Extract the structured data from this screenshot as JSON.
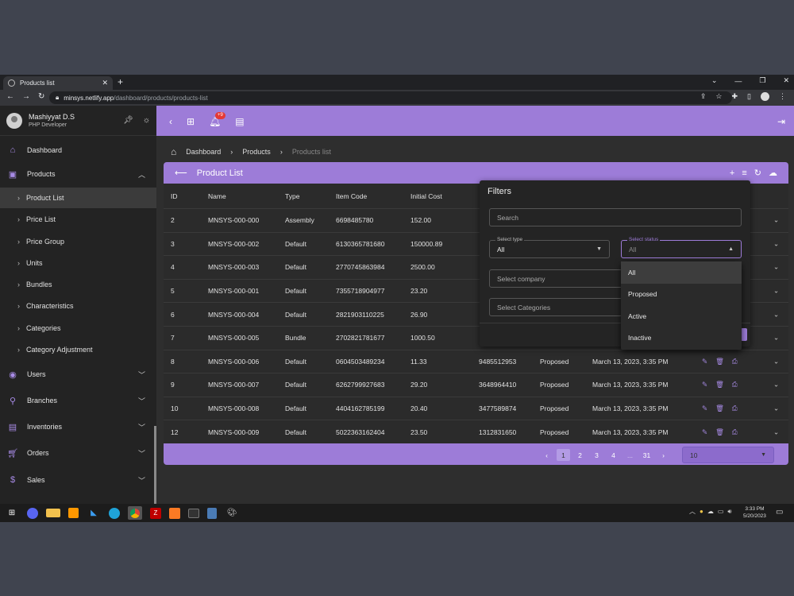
{
  "browser": {
    "tab_title": "Products list",
    "url_host": "minsys.netlify.app",
    "url_path": "/dashboard/products/products-list"
  },
  "user": {
    "name": "Mashiyyat D.S",
    "role": "PHP Developer"
  },
  "sidebar": {
    "items": [
      {
        "label": "Dashboard"
      },
      {
        "label": "Products"
      }
    ],
    "sub_items": [
      {
        "label": "Product List"
      },
      {
        "label": "Price List"
      },
      {
        "label": "Price Group"
      },
      {
        "label": "Units"
      },
      {
        "label": "Bundles"
      },
      {
        "label": "Characteristics"
      },
      {
        "label": "Categories"
      },
      {
        "label": "Category Adjustment"
      }
    ],
    "lower_items": [
      {
        "label": "Users"
      },
      {
        "label": "Branches"
      },
      {
        "label": "Inventories"
      },
      {
        "label": "Orders"
      },
      {
        "label": "Sales"
      }
    ]
  },
  "topbar": {
    "notification_count": "+9"
  },
  "breadcrumb": {
    "home": "Dashboard",
    "section": "Products",
    "current": "Products list"
  },
  "card": {
    "title": "Product List"
  },
  "table": {
    "headers": {
      "id": "ID",
      "name": "Name",
      "type": "Type",
      "code": "Item Code",
      "cost": "Initial Cost"
    },
    "rows": [
      {
        "id": "2",
        "name": "MNSYS-000-000",
        "type": "Assembly",
        "code": "6698485780",
        "cost": "152.00",
        "x": "",
        "status": "",
        "date": ""
      },
      {
        "id": "3",
        "name": "MNSYS-000-002",
        "type": "Default",
        "code": "6130365781680",
        "cost": "150000.89",
        "x": "",
        "status": "",
        "date": ""
      },
      {
        "id": "4",
        "name": "MNSYS-000-003",
        "type": "Default",
        "code": "2770745863984",
        "cost": "2500.00",
        "x": "",
        "status": "",
        "date": ""
      },
      {
        "id": "5",
        "name": "MNSYS-000-001",
        "type": "Default",
        "code": "7355718904977",
        "cost": "23.20",
        "x": "",
        "status": "",
        "date": ""
      },
      {
        "id": "6",
        "name": "MNSYS-000-004",
        "type": "Default",
        "code": "2821903110225",
        "cost": "26.90",
        "x": "",
        "status": "",
        "date": ""
      },
      {
        "id": "7",
        "name": "MNSYS-000-005",
        "type": "Bundle",
        "code": "2702821781677",
        "cost": "1000.50",
        "x": "",
        "status": "",
        "date": ""
      },
      {
        "id": "8",
        "name": "MNSYS-000-006",
        "type": "Default",
        "code": "0604503489234",
        "cost": "11.33",
        "x": "9485512953",
        "status": "Proposed",
        "date": "March 13, 2023, 3:35 PM"
      },
      {
        "id": "9",
        "name": "MNSYS-000-007",
        "type": "Default",
        "code": "6262799927683",
        "cost": "29.20",
        "x": "3648964410",
        "status": "Proposed",
        "date": "March 13, 2023, 3:35 PM"
      },
      {
        "id": "10",
        "name": "MNSYS-000-008",
        "type": "Default",
        "code": "4404162785199",
        "cost": "20.40",
        "x": "3477589874",
        "status": "Proposed",
        "date": "March 13, 2023, 3:35 PM"
      },
      {
        "id": "12",
        "name": "MNSYS-000-009",
        "type": "Default",
        "code": "5022363162404",
        "cost": "23.50",
        "x": "1312831650",
        "status": "Proposed",
        "date": "March 13, 2023, 3:35 PM"
      }
    ]
  },
  "pagination": {
    "pages": [
      "1",
      "2",
      "3",
      "4",
      "...",
      "31"
    ],
    "current": "1",
    "page_size": "10"
  },
  "filters": {
    "title": "Filters",
    "search_placeholder": "Search",
    "type_label": "Select type",
    "type_value": "All",
    "status_label": "Select status",
    "status_value": "All",
    "company_placeholder": "Select company",
    "categories_placeholder": "Select Categories",
    "status_options": [
      "All",
      "Proposed",
      "Active",
      "Inactive"
    ]
  },
  "clock": {
    "time": "3:33 PM",
    "date": "5/20/2023"
  },
  "colors": {
    "accent": "#9d7cd8",
    "sidebar": "#232323",
    "content": "#2e2e2e"
  }
}
